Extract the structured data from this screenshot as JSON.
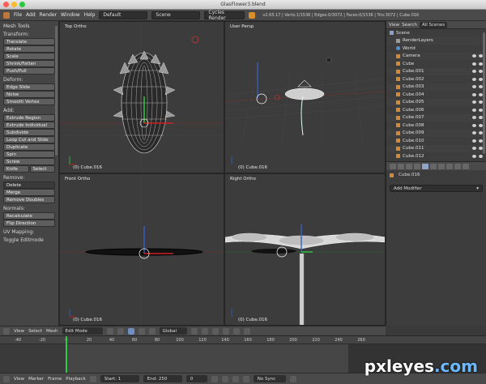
{
  "window": {
    "title": "GlasFlower3.blend"
  },
  "infobar": {
    "menus": [
      "File",
      "Add",
      "Render",
      "Window",
      "Help"
    ],
    "layout": "Default",
    "scene": "Scene",
    "engine": "Cycles Render",
    "stats": "v2.65.17 | Verts:1/1536 | Edges:0/3072 | Faces:0/1536 | Tris:3072 | Cube.016"
  },
  "toolshelf": {
    "header": "Mesh Tools",
    "transform_label": "Transform:",
    "transform": [
      "Translate",
      "Rotate",
      "Scale",
      "Shrink/Fatten",
      "Push/Pull"
    ],
    "deform_label": "Deform:",
    "deform": [
      "Edge Slide",
      "Noise",
      "Smooth Vertex"
    ],
    "add_label": "Add:",
    "add": [
      "Extrude Region",
      "Extrude Individual",
      "Subdivide",
      "Loop Cut and Slide",
      "Duplicate",
      "Spin",
      "Screw"
    ],
    "knife": "Knife",
    "select": "Select",
    "remove_label": "Remove:",
    "delete": "Delete",
    "remove": [
      "Merge",
      "Remove Doubles"
    ],
    "normals_label": "Normals:",
    "normals": [
      "Recalculate",
      "Flip Direction"
    ],
    "uv_label": "UV Mapping:",
    "toggle": "Toggle Editmode"
  },
  "viewports": {
    "top": {
      "label": "Top Ortho",
      "object": "(0) Cube.016"
    },
    "persp": {
      "label": "User Persp",
      "object": "(0) Cube.016"
    },
    "front": {
      "label": "Front Ortho",
      "object": "(0) Cube.016"
    },
    "right": {
      "label": "Right Ortho",
      "object": "(0) Cube.016"
    }
  },
  "outliner": {
    "view": "View",
    "search": "Search",
    "filter": "All Scenes",
    "items": [
      "Scene",
      "RenderLayers",
      "World",
      "Camera",
      "Cube",
      "Cube.001",
      "Cube.002",
      "Cube.003",
      "Cube.004",
      "Cube.005",
      "Cube.006",
      "Cube.007",
      "Cube.008",
      "Cube.009",
      "Cube.010",
      "Cube.011",
      "Cube.012"
    ]
  },
  "properties": {
    "object": "Cube.016",
    "add_modifier": "Add Modifier"
  },
  "viewheader": {
    "menus": [
      "View",
      "Select",
      "Mesh"
    ],
    "mode": "Edit Mode",
    "orientation": "Global"
  },
  "timeline": {
    "ticks": [
      "-40",
      "-20",
      "0",
      "20",
      "40",
      "60",
      "80",
      "100",
      "120",
      "140",
      "160",
      "180",
      "200",
      "220",
      "240",
      "260"
    ]
  },
  "footer": {
    "menus": [
      "View",
      "Marker",
      "Frame",
      "Playback"
    ],
    "start": "Start: 1",
    "end": "End: 250",
    "current": "0",
    "sync": "No Sync"
  },
  "watermark": {
    "text": "pxleyes",
    "suffix": ".com"
  },
  "colors": {
    "accent": "#c0773c",
    "selected": "#8fa6c9",
    "cursor": "#2ecc40"
  }
}
